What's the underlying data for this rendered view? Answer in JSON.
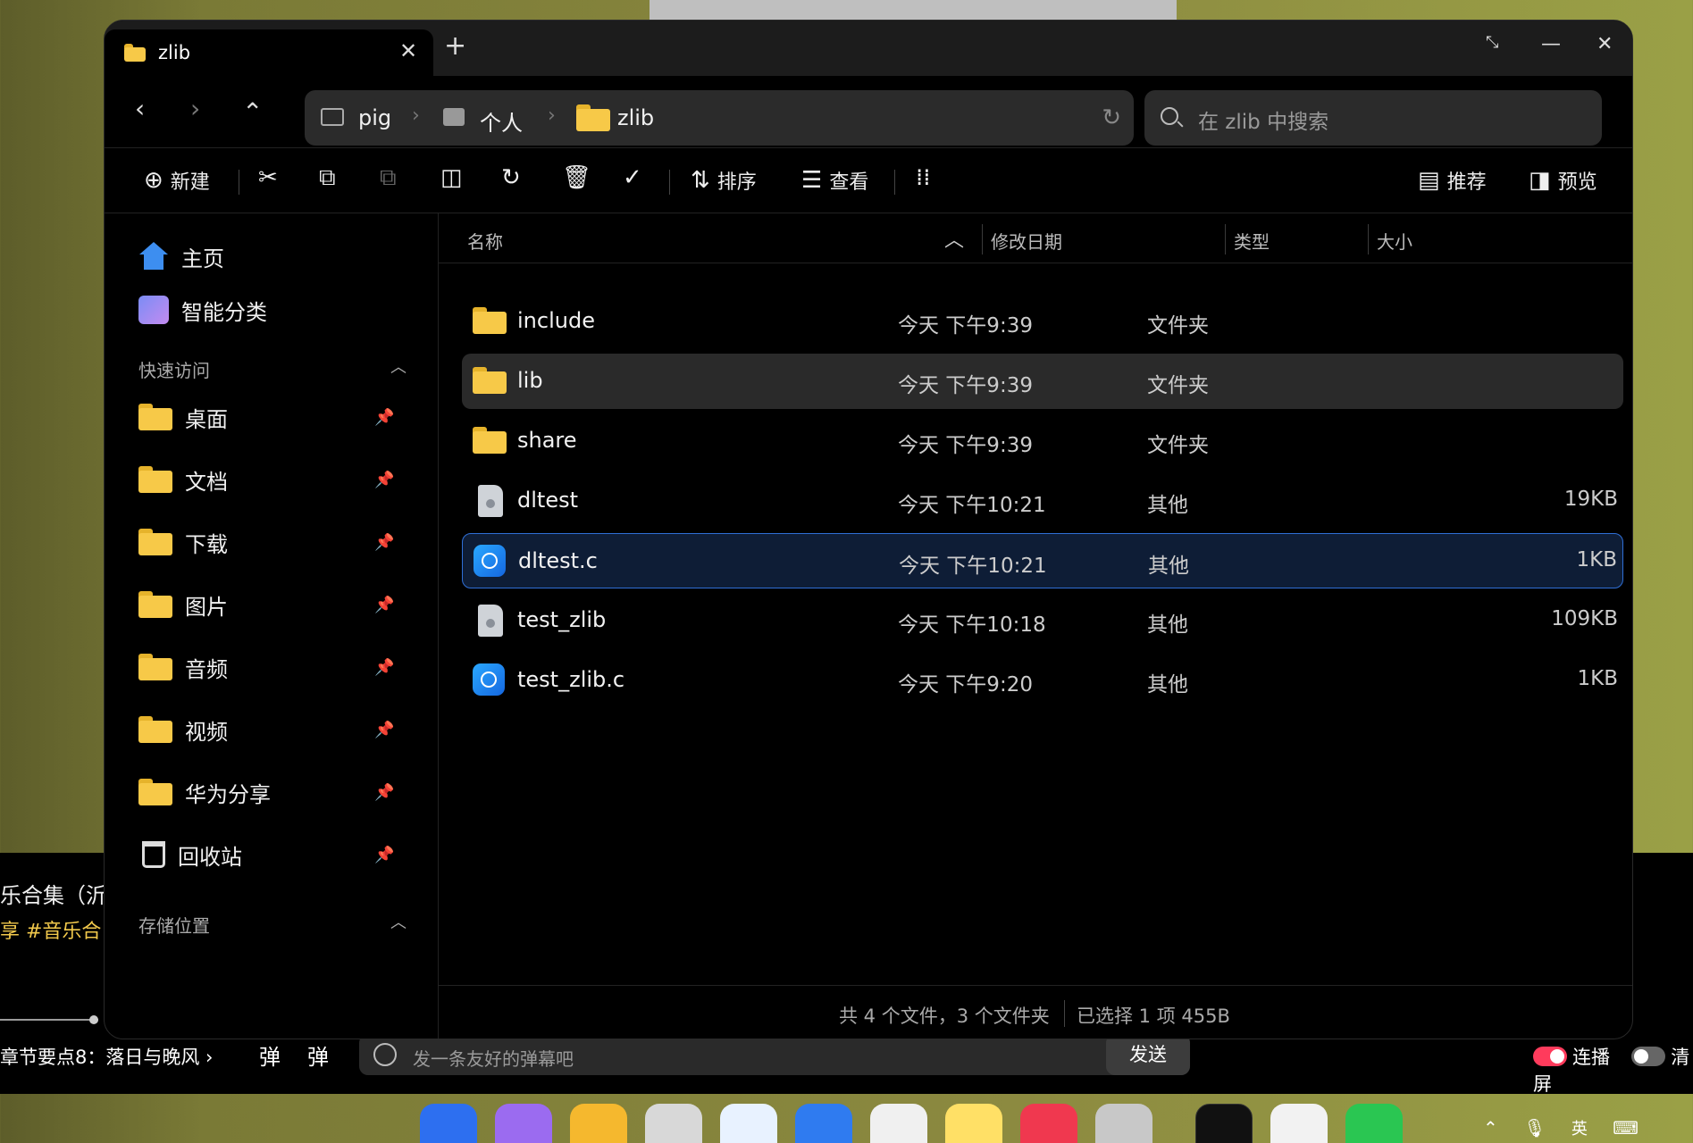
{
  "window": {
    "tab_title": "zlib",
    "add_tab": "+",
    "btn_restore": "⤡",
    "btn_minimize": "—",
    "btn_close": "✕"
  },
  "nav": {
    "back": "‹",
    "forward": "›",
    "up": "⌃",
    "breadcrumb": [
      "pig",
      "个人",
      "zlib"
    ],
    "search_placeholder": "在 zlib 中搜索"
  },
  "toolbar": {
    "new": "新建",
    "sort": "排序",
    "view": "查看",
    "recommend": "推荐",
    "preview": "预览"
  },
  "sidebar": {
    "home": "主页",
    "smart": "智能分类",
    "quick_access_title": "快速访问",
    "quick_access": [
      "桌面",
      "文档",
      "下载",
      "图片",
      "音频",
      "视频",
      "华为分享"
    ],
    "recycle": "回收站",
    "storage_title": "存储位置"
  },
  "columns": {
    "name": "名称",
    "date": "修改日期",
    "type": "类型",
    "size": "大小"
  },
  "files": [
    {
      "name": "include",
      "date": "今天 下午9:39",
      "type": "文件夹",
      "size": "",
      "icon": "folder-icon"
    },
    {
      "name": "lib",
      "date": "今天 下午9:39",
      "type": "文件夹",
      "size": "",
      "icon": "folder-icon"
    },
    {
      "name": "share",
      "date": "今天 下午9:39",
      "type": "文件夹",
      "size": "",
      "icon": "folder-icon"
    },
    {
      "name": "dltest",
      "date": "今天 下午10:21",
      "type": "其他",
      "size": "19KB",
      "icon": "generic-file-icon"
    },
    {
      "name": "dltest.c",
      "date": "今天 下午10:21",
      "type": "其他",
      "size": "1KB",
      "icon": "c-source-icon"
    },
    {
      "name": "test_zlib",
      "date": "今天 下午10:18",
      "type": "其他",
      "size": "109KB",
      "icon": "generic-file-icon"
    },
    {
      "name": "test_zlib.c",
      "date": "今天 下午9:20",
      "type": "其他",
      "size": "1KB",
      "icon": "c-source-icon"
    }
  ],
  "status": {
    "count": "共 4 个文件，3 个文件夹",
    "selection": "已选择 1 项  455B"
  },
  "background_video": {
    "title_fragment": "乐合集（沂",
    "tags_fragment": "享  #音乐合",
    "chapter": "章节要点8：落日与晚风 ›",
    "danmaku_placeholder": "发一条友好的弹幕吧",
    "send": "发送",
    "autoplay": "连播",
    "clear": "清屏"
  },
  "tray": {
    "ime": "英"
  },
  "colors": {
    "accent": "#2f6fd6",
    "folder": "#f7c948",
    "window_bg": "#000000"
  }
}
